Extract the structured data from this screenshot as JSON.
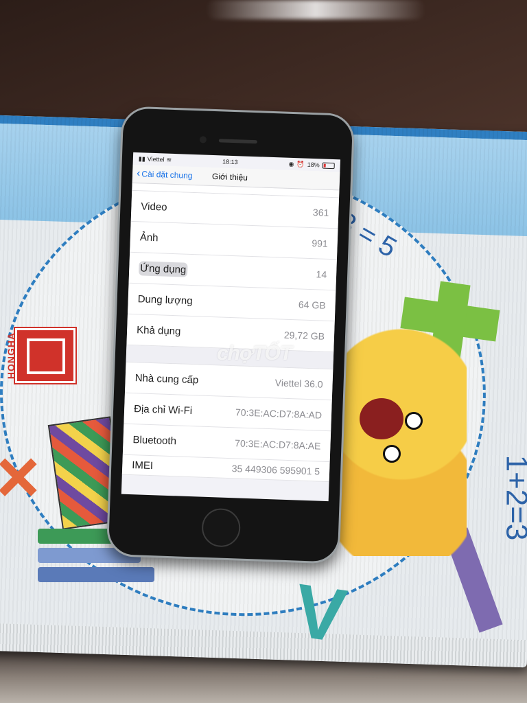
{
  "photo": {
    "brand": "HONGHA",
    "watermark": "chợTỐT",
    "math_text_1": "3 = 5",
    "math_text_2": "1+2=3"
  },
  "status_bar": {
    "carrier": "Viettel",
    "time": "18:13",
    "battery": "18%"
  },
  "nav": {
    "back_label": "Cài đặt chung",
    "title": "Giới thiệu"
  },
  "about": {
    "group1": [
      {
        "label": "Video",
        "value": "361"
      },
      {
        "label": "Ảnh",
        "value": "991"
      },
      {
        "label": "Ứng dụng",
        "value": "14"
      },
      {
        "label": "Dung lượng",
        "value": "64 GB"
      },
      {
        "label": "Khả dụng",
        "value": "29,72 GB"
      }
    ],
    "group2": [
      {
        "label": "Nhà cung cấp",
        "value": "Viettel 36.0"
      },
      {
        "label": "Địa chỉ Wi-Fi",
        "value": "70:3E:AC:D7:8A:AD"
      },
      {
        "label": "Bluetooth",
        "value": "70:3E:AC:D7:8A:AE"
      },
      {
        "label": "IMEI",
        "value": "35 449306 595901 5"
      }
    ]
  },
  "colors": {
    "ios_blue": "#1a73e8",
    "battery_low": "#dd3333"
  }
}
